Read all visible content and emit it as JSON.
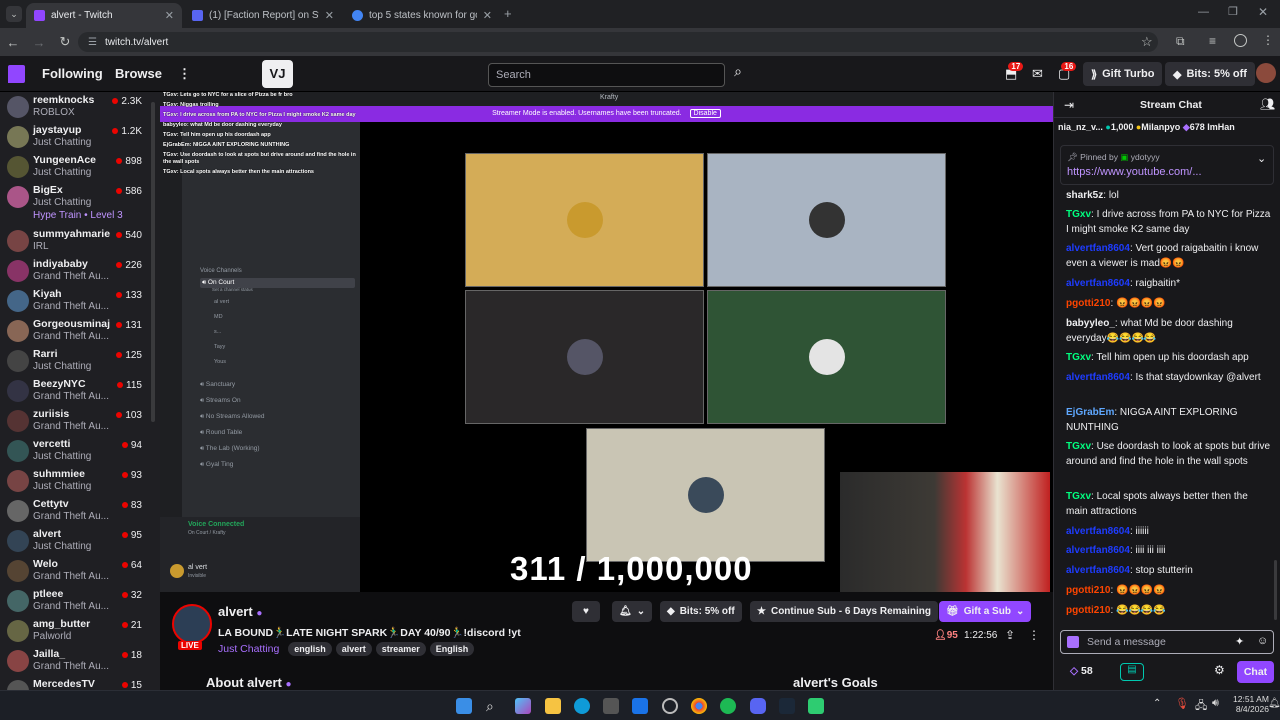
{
  "browser": {
    "tabs": [
      {
        "title": "alvert - Twitch",
        "active": true,
        "color": "#9146ff"
      },
      {
        "title": "(1) [Faction Report] on Stewart",
        "active": false,
        "color": "#5865f2"
      },
      {
        "title": "top 5 states known for good p",
        "active": false,
        "color": "#4285f4"
      }
    ],
    "url": "twitch.tv/alvert"
  },
  "topnav": {
    "following": "Following",
    "browse": "Browse",
    "search_placeholder": "Search",
    "inbox_badge": "17",
    "notif_badge": "16",
    "gift_turbo": "Gift Turbo",
    "bits": "Bits: 5% off"
  },
  "sidebar": {
    "channels": [
      {
        "name": "reemknocks",
        "game": "ROBLOX",
        "viewers": "2.3K",
        "color": "#556"
      },
      {
        "name": "jaystayup",
        "game": "Just Chatting",
        "viewers": "1.2K",
        "color": "#775"
      },
      {
        "name": "YungeenAce",
        "game": "Just Chatting",
        "viewers": "898",
        "color": "#553"
      },
      {
        "name": "BigEx",
        "game": "Just Chatting",
        "viewers": "586",
        "color": "#a58",
        "extra": "Hype Train • Level 3"
      },
      {
        "name": "summyahmarie",
        "game": "IRL",
        "viewers": "540",
        "color": "#744"
      },
      {
        "name": "indiyababy",
        "game": "Grand Theft Au...",
        "viewers": "226",
        "color": "#836"
      },
      {
        "name": "Kiyah",
        "game": "Grand Theft Au...",
        "viewers": "133",
        "color": "#468"
      },
      {
        "name": "Gorgeousminaj",
        "game": "Grand Theft Au...",
        "viewers": "131",
        "color": "#865"
      },
      {
        "name": "Rarri",
        "game": "Just Chatting",
        "viewers": "125",
        "color": "#444"
      },
      {
        "name": "BeezyNYC",
        "game": "Grand Theft Au...",
        "viewers": "115",
        "color": "#334"
      },
      {
        "name": "zuriisis",
        "game": "Grand Theft Au...",
        "viewers": "103",
        "color": "#533"
      },
      {
        "name": "vercetti",
        "game": "Just Chatting",
        "viewers": "94",
        "color": "#355"
      },
      {
        "name": "suhmmiee",
        "game": "Just Chatting",
        "viewers": "93",
        "color": "#744"
      },
      {
        "name": "Cettytv",
        "game": "Grand Theft Au...",
        "viewers": "83",
        "color": "#666"
      },
      {
        "name": "alvert",
        "game": "Just Chatting",
        "viewers": "95",
        "color": "#345"
      },
      {
        "name": "Welo",
        "game": "Grand Theft Au...",
        "viewers": "64",
        "color": "#543"
      },
      {
        "name": "ptleee",
        "game": "Grand Theft Au...",
        "viewers": "32",
        "color": "#466"
      },
      {
        "name": "amg_butter",
        "game": "Palworld",
        "viewers": "21",
        "color": "#664"
      },
      {
        "name": "Jailla_",
        "game": "Grand Theft Au...",
        "viewers": "18",
        "color": "#844"
      },
      {
        "name": "MercedesTV",
        "game": "",
        "viewers": "15",
        "color": "#555"
      }
    ]
  },
  "video": {
    "app_title": "Krafty",
    "banner": "Streamer Mode is enabled. Usernames have been truncated.",
    "banner_btn": "Disable",
    "voice_header": "Voice Channels",
    "channels": [
      "On Court",
      "Sanctuary",
      "Streams On",
      "No Streams Allowed",
      "Round Table",
      "The Lab (Working)",
      "Gyal Ting"
    ],
    "on_court_status": "Set a channel status",
    "members": [
      "al vert",
      "MD",
      "s...",
      "Tayy",
      "Yous"
    ],
    "voice_connected": "Voice Connected",
    "voice_sub": "On Court / Krafty",
    "user": "al vert",
    "user_status": "Invisible",
    "overlay_chat": [
      "TGxv: Lets go to NYC for a slice of Pizza be fr bro",
      "TGxv: Niggas trolling",
      "TGxv: I drive across from PA to NYC for Pizza I might smoke K2 same day",
      "babyyleo: what Md be door dashing everyday",
      "TGxv: Tell him open up his doordash app",
      "EjGrabEm: NIGGA AINT EXPLORING NUNTHING",
      "TGxv: Use doordash to look at spots but drive around and find the hole in the wall spots",
      "TGxv: Local spots always better then the main attractions"
    ],
    "tiles": [
      {
        "bg": "#d4ac57",
        "avatar": "#c99a2e"
      },
      {
        "bg": "#a9b4c2",
        "avatar": "#333"
      },
      {
        "bg": "#2a2829",
        "avatar": "#556"
      },
      {
        "bg": "#2f5435",
        "avatar": "#e4e4e4"
      },
      {
        "bg": "#c9c5b4",
        "avatar": "#3a4a5a"
      }
    ],
    "counter": "311 / 1,000,000"
  },
  "stream": {
    "name": "alvert",
    "title": "LA BOUND🏃‍♂️LATE NIGHT SPARK🏃‍♂️DAY 40/90🏃‍♂️!discord !yt",
    "category": "Just Chatting",
    "tags": [
      "english",
      "alvert",
      "streamer",
      "English"
    ],
    "live": "LIVE",
    "viewers": "95",
    "uptime": "1:22:56",
    "bits_btn": "Bits: 5% off",
    "continue_sub": "Continue Sub - 6 Days Remaining",
    "gift_sub": "Gift a Sub",
    "about": "About alvert",
    "goals": "alvert's Goals"
  },
  "chat": {
    "title": "Stream Chat",
    "leaderboard": [
      "nia_nz_v...",
      "1,000",
      "Milanpyo",
      "678",
      "ImHan"
    ],
    "pinned_by": "Pinned by",
    "pinned_user": "ydotyyy",
    "pinned_link": "https://www.youtube.com/...",
    "messages": [
      {
        "user": "shark5z",
        "color": "#efeff1",
        "text": "lol"
      },
      {
        "user": "TGxv",
        "color": "#00ff7f",
        "text": "I drive across from PA to NYC for Pizza I might smoke K2 same day"
      },
      {
        "user": "alvertfan8604",
        "color": "#1e3cff",
        "text": "Vert good raigabaitin i know even a viewer is mad😡😡"
      },
      {
        "user": "alvertfan8604",
        "color": "#1e3cff",
        "text": "raigbaitin*"
      },
      {
        "user": "pgotti210",
        "color": "#ff4500",
        "text": "😡😡😡😡"
      },
      {
        "user": "babyyleo_",
        "color": "#efeff1",
        "text": "what Md be door dashing everyday😂😂😂😂"
      },
      {
        "user": "TGxv",
        "color": "#00ff7f",
        "text": "Tell him open up his doordash app"
      },
      {
        "user": "alvertfan8604",
        "color": "#1e3cff",
        "text": "Is that staydownkay @alvert"
      },
      {
        "user": "EjGrabEm",
        "color": "#5fa8ff",
        "text": "NIGGA AINT EXPLORING NUNTHING"
      },
      {
        "user": "TGxv",
        "color": "#00ff7f",
        "text": "Use doordash to look at spots but drive around and find the hole in the wall spots"
      },
      {
        "user": "TGxv",
        "color": "#00ff7f",
        "text": "Local spots always better then the main attractions"
      },
      {
        "user": "alvertfan8604",
        "color": "#1e3cff",
        "text": "iiiiii"
      },
      {
        "user": "alvertfan8604",
        "color": "#1e3cff",
        "text": "iiii iii iiii"
      },
      {
        "user": "alvertfan8604",
        "color": "#1e3cff",
        "text": "stop stutterin"
      },
      {
        "user": "pgotti210",
        "color": "#ff4500",
        "text": "😡😡😡😡"
      },
      {
        "user": "pgotti210",
        "color": "#ff4500",
        "text": "😂😂😂😂"
      }
    ],
    "input_placeholder": "Send a message",
    "points": "58",
    "chat_btn": "Chat"
  },
  "taskbar": {
    "time": "12:51 AM",
    "date": "8/4/2026"
  }
}
